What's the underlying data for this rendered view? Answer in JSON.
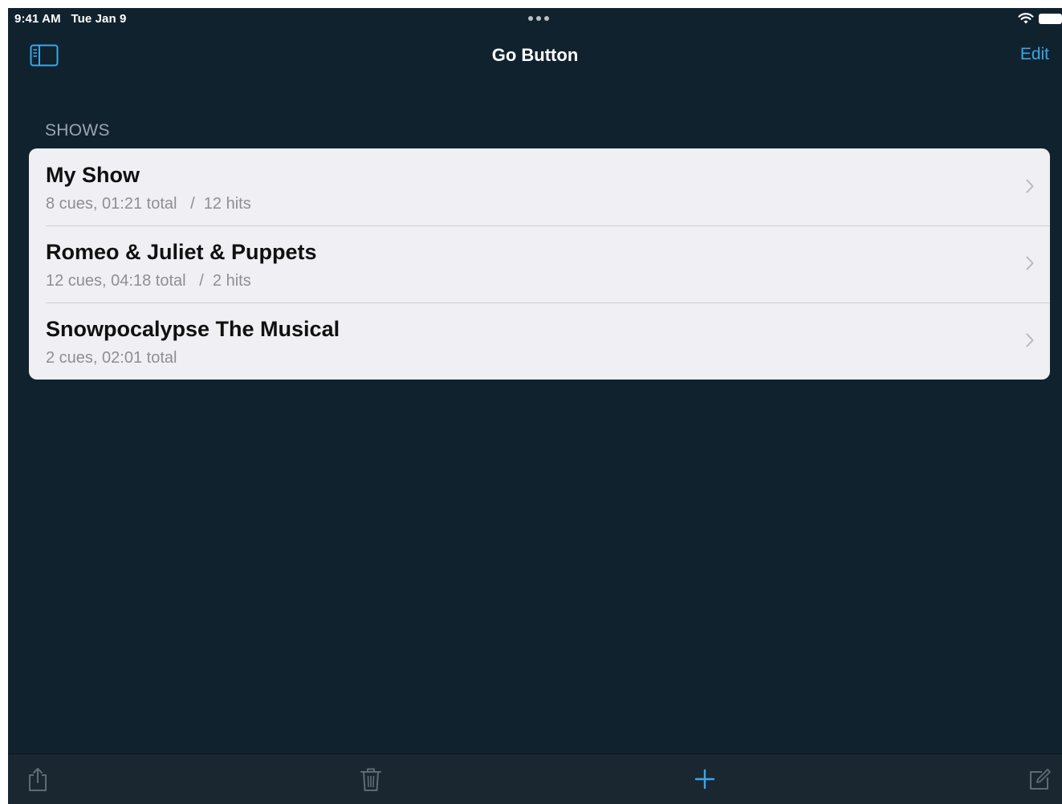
{
  "status_bar": {
    "time": "9:41 AM",
    "date": "Tue Jan 9"
  },
  "nav": {
    "title": "Go Button",
    "edit_label": "Edit",
    "sidebar_icon": "sidebar-toggle-icon"
  },
  "section": {
    "header": "SHOWS"
  },
  "shows": [
    {
      "title": "My Show",
      "subtitle": "8 cues, 01:21 total   /  12 hits"
    },
    {
      "title": "Romeo & Juliet & Puppets",
      "subtitle": "12 cues, 04:18 total   /  2 hits"
    },
    {
      "title": "Snowpocalypse The Musical",
      "subtitle": "2 cues, 02:01 total"
    }
  ],
  "toolbar": {
    "icons": [
      "share-icon",
      "trash-icon",
      "plus-icon",
      "compose-icon"
    ]
  },
  "colors": {
    "background": "#11222f",
    "accent": "#3aa7e6",
    "card": "#efeff4",
    "toolbar_icon": "#5f6b74"
  }
}
